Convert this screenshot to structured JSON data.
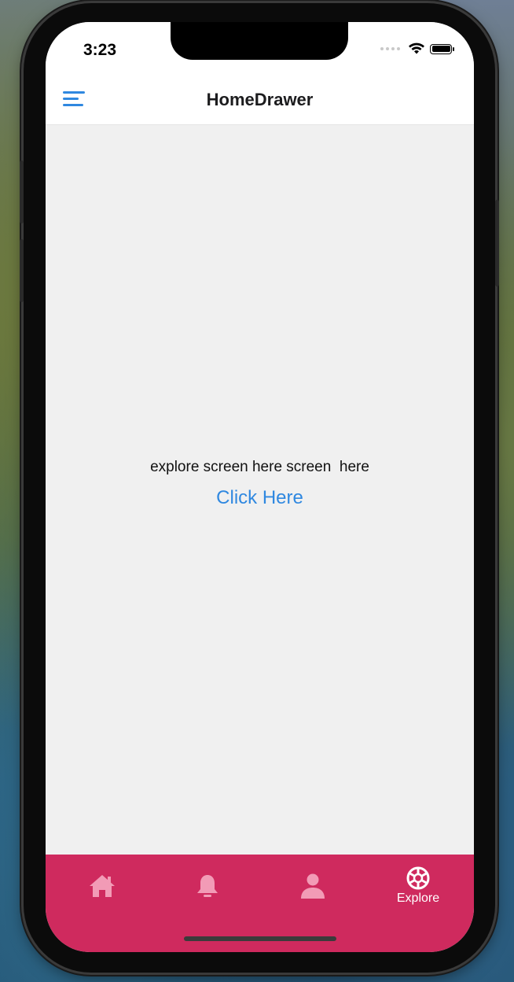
{
  "status_bar": {
    "time": "3:23"
  },
  "header": {
    "title": "HomeDrawer",
    "menu_icon": "hamburger-menu-icon"
  },
  "main": {
    "message": "explore screen here screen  here",
    "link_label": "Click Here"
  },
  "tabbar": {
    "background": "#cf2a5e",
    "tabs": [
      {
        "icon": "home-icon",
        "label": "",
        "active": false
      },
      {
        "icon": "bell-icon",
        "label": "",
        "active": false
      },
      {
        "icon": "person-icon",
        "label": "",
        "active": false
      },
      {
        "icon": "aperture-icon",
        "label": "Explore",
        "active": true
      }
    ]
  },
  "colors": {
    "accent": "#2f88e0",
    "inactive_tab_icon": "#f29bb6",
    "active_tab": "#ffffff"
  }
}
